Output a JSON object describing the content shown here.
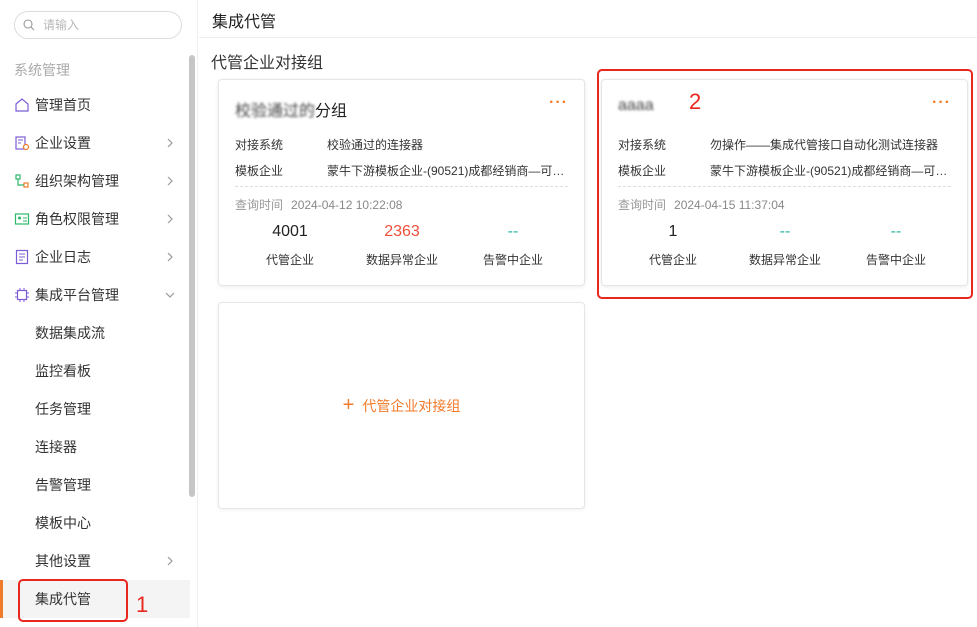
{
  "search": {
    "placeholder": "请输入"
  },
  "sidebar": {
    "section_title": "系统管理",
    "items": [
      {
        "label": "管理首页",
        "icon": "home-icon"
      },
      {
        "label": "企业设置",
        "icon": "building-settings-icon"
      },
      {
        "label": "组织架构管理",
        "icon": "org-chart-icon"
      },
      {
        "label": "角色权限管理",
        "icon": "id-card-icon"
      },
      {
        "label": "企业日志",
        "icon": "log-document-icon"
      },
      {
        "label": "集成平台管理",
        "icon": "chip-icon"
      }
    ],
    "sub_items": [
      {
        "label": "数据集成流"
      },
      {
        "label": "监控看板"
      },
      {
        "label": "任务管理"
      },
      {
        "label": "连接器"
      },
      {
        "label": "告警管理"
      },
      {
        "label": "模板中心"
      },
      {
        "label": "其他设置"
      },
      {
        "label": "集成代管"
      }
    ]
  },
  "header": {
    "title": "集成代管"
  },
  "main": {
    "group_title": "代管企业对接组",
    "cards": [
      {
        "name_blurred": "校验通过的",
        "name_suffix": "分组",
        "more": "···",
        "system_label": "对接系统",
        "system_value": "校验通过的连接器",
        "template_label": "模板企业",
        "template_value": "蒙牛下游模板企业-(90521)成都经销商—可…",
        "query_label": "查询时间",
        "query_time": "2024-04-12 10:22:08",
        "stats": [
          {
            "value": "4001",
            "caption": "代管企业"
          },
          {
            "value": "2363",
            "caption": "数据异常企业"
          },
          {
            "value": "--",
            "caption": "告警中企业"
          }
        ]
      },
      {
        "name_blurred": "aaaa",
        "more": "···",
        "system_label": "对接系统",
        "system_value": "勿操作——集成代管接口自动化测试连接器",
        "template_label": "模板企业",
        "template_value": "蒙牛下游模板企业-(90521)成都经销商—可…",
        "query_label": "查询时间",
        "query_time": "2024-04-15 11:37:04",
        "stats": [
          {
            "value": "1",
            "caption": "代管企业"
          },
          {
            "value": "--",
            "caption": "数据异常企业"
          },
          {
            "value": "--",
            "caption": "告警中企业"
          }
        ]
      }
    ],
    "add_label": "代管企业对接组"
  },
  "annotations": {
    "one": "1",
    "two": "2"
  },
  "colors": {
    "accent": "#f07b2a",
    "danger": "#ef4f3a",
    "teal": "#2bb8a6",
    "annotation": "#e8281f"
  }
}
